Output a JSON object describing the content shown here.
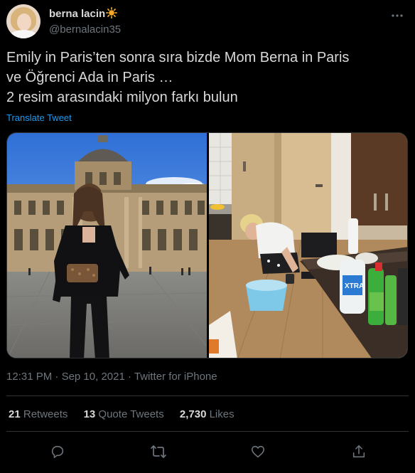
{
  "author": {
    "display_name": "berna lacin",
    "badge_icon": "sun-emoji-icon",
    "handle": "@bernalacin35"
  },
  "tweet": {
    "lines": [
      "Emily in Paris’ten sonra sıra bizde Mom Berna in Paris",
      "ve Öğrenci Ada in Paris …",
      "2 resim arasındaki milyon farkı bulun"
    ],
    "translate_label": "Translate Tweet"
  },
  "meta": {
    "time": "12:31 PM",
    "separator": " · ",
    "date": "Sep 10, 2021",
    "source": "Twitter for iPhone"
  },
  "stats": {
    "retweets_count": "21",
    "retweets_label": "Retweets",
    "quotes_count": "13",
    "quotes_label": "Quote Tweets",
    "likes_count": "2,730",
    "likes_label": "Likes"
  },
  "actions": {
    "reply_icon": "reply-icon",
    "retweet_icon": "retweet-icon",
    "like_icon": "heart-icon",
    "share_icon": "share-icon"
  },
  "colors": {
    "background": "#000000",
    "text": "#d9d9d9",
    "secondary": "#6e767d",
    "link": "#1d9bf0",
    "divider": "#2f3336"
  }
}
